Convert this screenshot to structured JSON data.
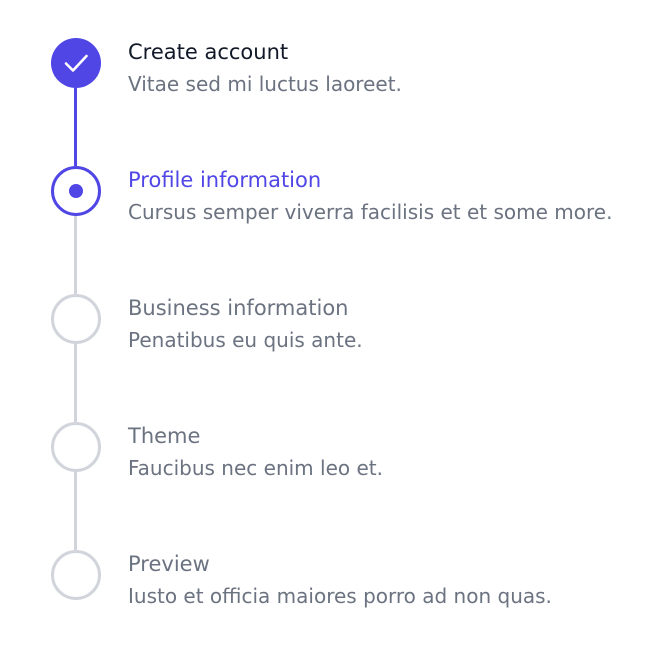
{
  "steps": [
    {
      "title": "Create account",
      "description": "Vitae sed mi luctus laoreet.",
      "status": "complete"
    },
    {
      "title": "Profile information",
      "description": "Cursus semper viverra facilisis et et some more.",
      "status": "current"
    },
    {
      "title": "Business information",
      "description": "Penatibus eu quis ante.",
      "status": "upcoming"
    },
    {
      "title": "Theme",
      "description": "Faucibus nec enim leo et.",
      "status": "upcoming"
    },
    {
      "title": "Preview",
      "description": "Iusto et officia maiores porro ad non quas.",
      "status": "upcoming"
    }
  ],
  "colors": {
    "accent": "#4f46e5",
    "inactive_border": "#d1d5db",
    "title_complete": "#111827",
    "muted_text": "#6b7280"
  },
  "icons": {
    "complete": "check-icon",
    "current": "dot-icon",
    "upcoming": "empty-circle-icon"
  }
}
